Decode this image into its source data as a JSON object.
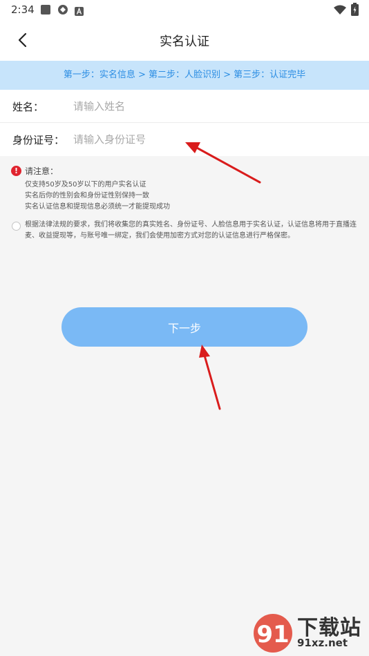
{
  "status_bar": {
    "time": "2:34",
    "icons": [
      "square-icon",
      "app-icon",
      "a-icon",
      "wifi-icon",
      "battery-icon"
    ]
  },
  "header": {
    "title": "实名认证",
    "back_icon": "chevron-left-icon"
  },
  "steps": {
    "text": "第一步：实名信息 > 第二步：人脸识别 > 第三步：认证完毕"
  },
  "form": {
    "name": {
      "label": "姓名：",
      "placeholder": "请输入姓名",
      "value": ""
    },
    "id_number": {
      "label": "身份证号：",
      "placeholder": "请输入身份证号",
      "value": ""
    }
  },
  "notice": {
    "icon": "exclamation-icon",
    "title": "请注意：",
    "lines": [
      "仅支持50岁及50岁以下的用户实名认证",
      "实名后你的性别会和身份证性别保持一致",
      "实名认证信息和提现信息必须统一才能提现成功"
    ]
  },
  "agreement": {
    "checked": false,
    "text": "根据法律法规的要求，我们将收集您的真实姓名、身份证号、人脸信息用于实名认证，认证信息将用于直播连麦、收益提现等，与账号唯一绑定，我们会使用加密方式对您的认证信息进行严格保密。"
  },
  "next_button": {
    "label": "下一步"
  },
  "watermark": {
    "title": "下载站",
    "url": "91xz.net"
  },
  "colors": {
    "accent": "#7ab9f5",
    "banner_bg": "#c7e4fb",
    "banner_text": "#2b8de3",
    "warning": "#e0242f",
    "annotation_arrow": "#d91c1c"
  }
}
